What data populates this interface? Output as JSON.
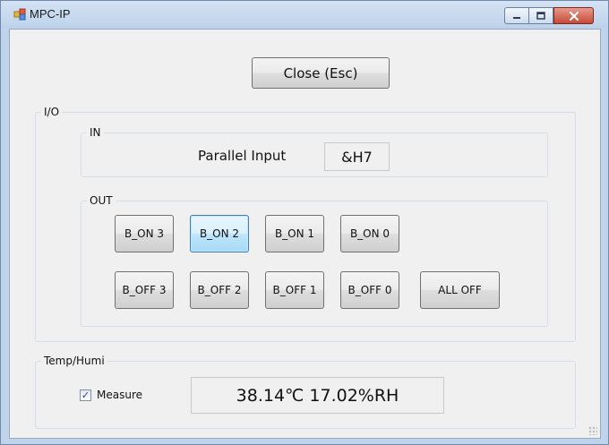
{
  "window": {
    "title": "MPC-IP",
    "icons": {
      "app": "app-window-icon",
      "minimize": "minimize-icon",
      "maximize": "maximize-icon",
      "close": "close-icon"
    }
  },
  "toolbar": {
    "close_label": "Close (Esc)"
  },
  "io_group": {
    "label": "I/O",
    "in_group": {
      "label": "IN",
      "parallel_label": "Parallel Input",
      "parallel_value": "&H7"
    },
    "out_group": {
      "label": "OUT",
      "on_buttons": [
        "B_ON 3",
        "B_ON 2",
        "B_ON 1",
        "B_ON 0"
      ],
      "off_buttons": [
        "B_OFF 3",
        "B_OFF 2",
        "B_OFF 1",
        "B_OFF 0"
      ],
      "all_off_label": "ALL OFF",
      "focused": "B_ON 2"
    }
  },
  "temp_group": {
    "label": "Temp/Humi",
    "measure_label": "Measure",
    "measure_checked": true,
    "reading": "38.14℃  17.02%RH"
  },
  "colors": {
    "titlebar": "#bfd3ea",
    "client": "#f0f0f0",
    "close_button": "#c84a35",
    "focus": "#3c7fb1"
  }
}
